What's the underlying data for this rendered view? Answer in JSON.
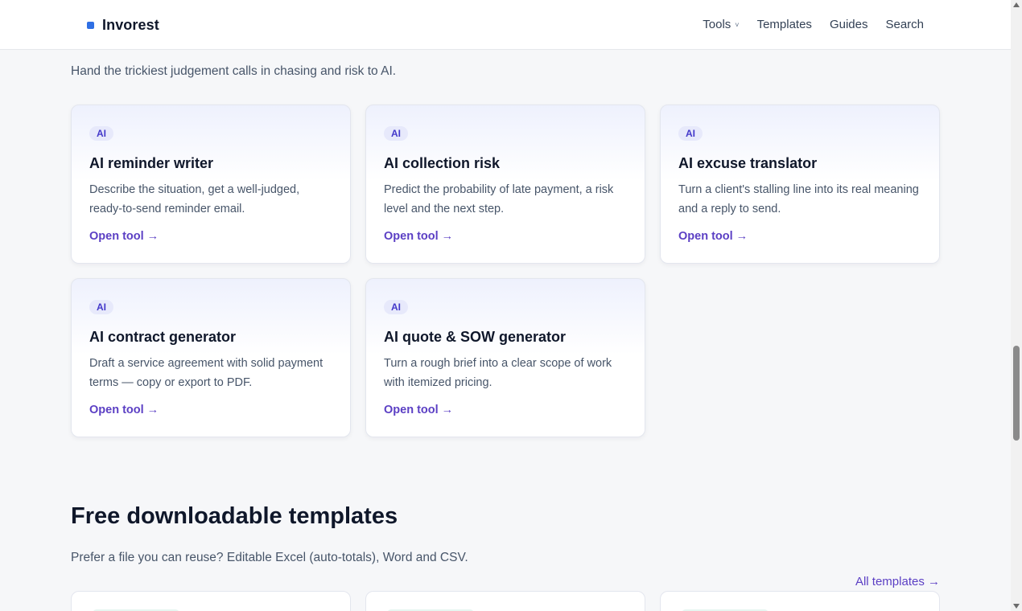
{
  "header": {
    "brand": "Invorest",
    "nav": [
      {
        "label": "Tools",
        "caret": "˅"
      },
      {
        "label": "Templates"
      },
      {
        "label": "Guides"
      },
      {
        "label": "Search"
      }
    ]
  },
  "ai_section": {
    "intro": "Hand the trickiest judgement calls in chasing and risk to AI.",
    "cards": [
      {
        "badge": "AI",
        "title": "AI reminder writer",
        "description": "Describe the situation, get a well-judged, ready-to-send reminder email.",
        "link": "Open tool →"
      },
      {
        "badge": "AI",
        "title": "AI collection risk",
        "description": "Predict the probability of late payment, a risk level and the next step.",
        "link": "Open tool →"
      },
      {
        "badge": "AI",
        "title": "AI excuse translator",
        "description": "Turn a client's stalling line into its real meaning and a reply to send.",
        "link": "Open tool →"
      },
      {
        "badge": "AI",
        "title": "AI contract generator",
        "description": "Draft a service agreement with solid payment terms — copy or export to PDF.",
        "link": "Open tool →"
      },
      {
        "badge": "AI",
        "title": "AI quote & SOW generator",
        "description": "Turn a rough brief into a clear scope of work with itemized pricing.",
        "link": "Open tool →"
      }
    ]
  },
  "templates_section": {
    "title": "Free downloadable templates",
    "subtitle": "Prefer a file you can reuse? Editable Excel (auto-totals), Word and CSV.",
    "all_link": "All templates →"
  },
  "colors": {
    "accent": "#5b3fc4",
    "brand_mark": "#2f6fe4",
    "badge_text": "#4338ca"
  }
}
